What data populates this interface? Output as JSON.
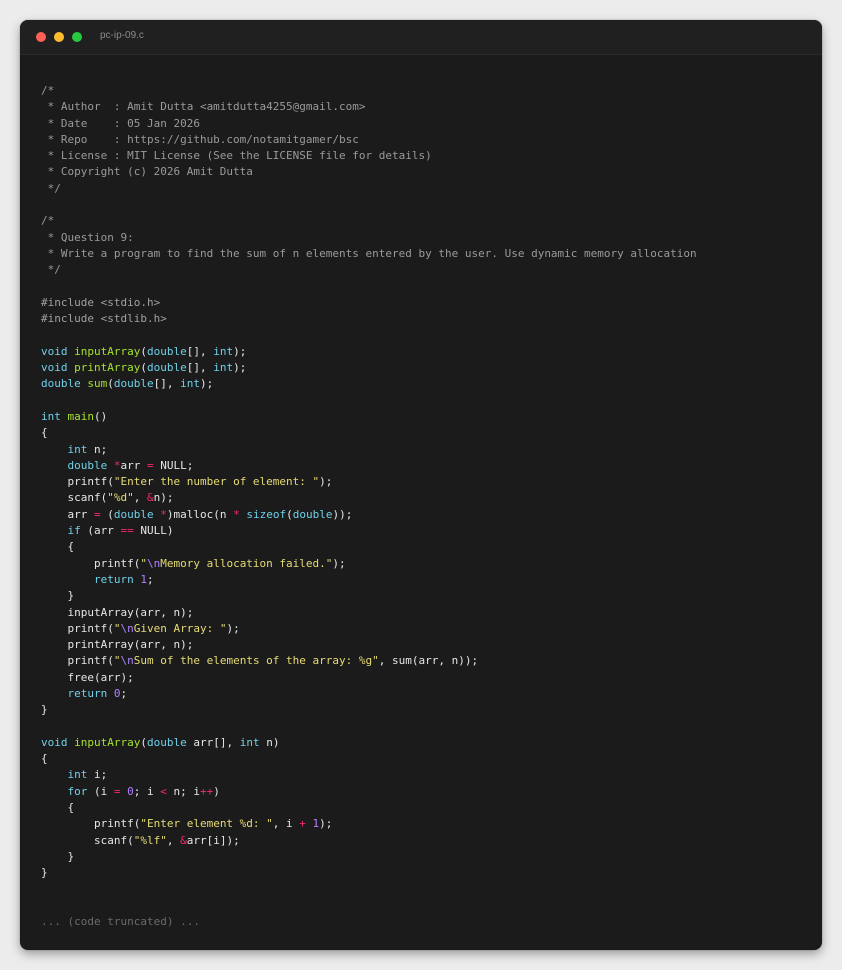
{
  "window": {
    "filename": "pc-ip-09.c"
  },
  "code_lines": [
    [
      [
        "c",
        "/*"
      ]
    ],
    [
      [
        "c",
        " * Author  : Amit Dutta <amitdutta4255@gmail.com>"
      ]
    ],
    [
      [
        "c",
        " * Date    : 05 Jan 2026"
      ]
    ],
    [
      [
        "c",
        " * Repo    : https://github.com/notamitgamer/bsc"
      ]
    ],
    [
      [
        "c",
        " * License : MIT License (See the LICENSE file for details)"
      ]
    ],
    [
      [
        "c",
        " * Copyright (c) 2026 Amit Dutta"
      ]
    ],
    [
      [
        "c",
        " */"
      ]
    ],
    [],
    [
      [
        "c",
        "/*"
      ]
    ],
    [
      [
        "c",
        " * Question 9:"
      ]
    ],
    [
      [
        "c",
        " * Write a program to find the sum of n elements entered by the user. Use dynamic memory allocation"
      ]
    ],
    [
      [
        "c",
        " */"
      ]
    ],
    [],
    [
      [
        "p",
        "#include <stdio.h>"
      ]
    ],
    [
      [
        "p",
        "#include <stdlib.h>"
      ]
    ],
    [],
    [
      [
        "k",
        "void"
      ],
      [
        "t",
        " "
      ],
      [
        "f",
        "inputArray"
      ],
      [
        "t",
        "("
      ],
      [
        "k",
        "double"
      ],
      [
        "t",
        "[], "
      ],
      [
        "k",
        "int"
      ],
      [
        "t",
        ");"
      ]
    ],
    [
      [
        "k",
        "void"
      ],
      [
        "t",
        " "
      ],
      [
        "f",
        "printArray"
      ],
      [
        "t",
        "("
      ],
      [
        "k",
        "double"
      ],
      [
        "t",
        "[], "
      ],
      [
        "k",
        "int"
      ],
      [
        "t",
        ");"
      ]
    ],
    [
      [
        "k",
        "double"
      ],
      [
        "t",
        " "
      ],
      [
        "f",
        "sum"
      ],
      [
        "t",
        "("
      ],
      [
        "k",
        "double"
      ],
      [
        "t",
        "[], "
      ],
      [
        "k",
        "int"
      ],
      [
        "t",
        ");"
      ]
    ],
    [],
    [
      [
        "k",
        "int"
      ],
      [
        "t",
        " "
      ],
      [
        "f",
        "main"
      ],
      [
        "t",
        "()"
      ]
    ],
    [
      [
        "t",
        "{"
      ]
    ],
    [
      [
        "t",
        "    "
      ],
      [
        "k",
        "int"
      ],
      [
        "t",
        " n;"
      ]
    ],
    [
      [
        "t",
        "    "
      ],
      [
        "k",
        "double"
      ],
      [
        "t",
        " "
      ],
      [
        "o",
        "*"
      ],
      [
        "t",
        "arr "
      ],
      [
        "o",
        "="
      ],
      [
        "t",
        " NULL;"
      ]
    ],
    [
      [
        "t",
        "    printf("
      ],
      [
        "s",
        "\"Enter the number of element: \""
      ],
      [
        "t",
        ");"
      ]
    ],
    [
      [
        "t",
        "    scanf("
      ],
      [
        "s",
        "\"%d\""
      ],
      [
        "t",
        ", "
      ],
      [
        "o",
        "&"
      ],
      [
        "t",
        "n);"
      ]
    ],
    [
      [
        "t",
        "    arr "
      ],
      [
        "o",
        "="
      ],
      [
        "t",
        " ("
      ],
      [
        "k",
        "double"
      ],
      [
        "t",
        " "
      ],
      [
        "o",
        "*"
      ],
      [
        "t",
        ")malloc(n "
      ],
      [
        "o",
        "*"
      ],
      [
        "t",
        " "
      ],
      [
        "k",
        "sizeof"
      ],
      [
        "t",
        "("
      ],
      [
        "k",
        "double"
      ],
      [
        "t",
        "));"
      ]
    ],
    [
      [
        "t",
        "    "
      ],
      [
        "k",
        "if"
      ],
      [
        "t",
        " (arr "
      ],
      [
        "o",
        "=="
      ],
      [
        "t",
        " NULL)"
      ]
    ],
    [
      [
        "t",
        "    {"
      ]
    ],
    [
      [
        "t",
        "        printf("
      ],
      [
        "s",
        "\""
      ],
      [
        "e",
        "\\n"
      ],
      [
        "s",
        "Memory allocation failed.\""
      ],
      [
        "t",
        ");"
      ]
    ],
    [
      [
        "t",
        "        "
      ],
      [
        "k",
        "return"
      ],
      [
        "t",
        " "
      ],
      [
        "n",
        "1"
      ],
      [
        "t",
        ";"
      ]
    ],
    [
      [
        "t",
        "    }"
      ]
    ],
    [
      [
        "t",
        "    inputArray(arr, n);"
      ]
    ],
    [
      [
        "t",
        "    printf("
      ],
      [
        "s",
        "\""
      ],
      [
        "e",
        "\\n"
      ],
      [
        "s",
        "Given Array: \""
      ],
      [
        "t",
        ");"
      ]
    ],
    [
      [
        "t",
        "    printArray(arr, n);"
      ]
    ],
    [
      [
        "t",
        "    printf("
      ],
      [
        "s",
        "\""
      ],
      [
        "e",
        "\\n"
      ],
      [
        "s",
        "Sum of the elements of the array: %g\""
      ],
      [
        "t",
        ", sum(arr, n));"
      ]
    ],
    [
      [
        "t",
        "    free(arr);"
      ]
    ],
    [
      [
        "t",
        "    "
      ],
      [
        "k",
        "return"
      ],
      [
        "t",
        " "
      ],
      [
        "n",
        "0"
      ],
      [
        "t",
        ";"
      ]
    ],
    [
      [
        "t",
        "}"
      ]
    ],
    [],
    [
      [
        "k",
        "void"
      ],
      [
        "t",
        " "
      ],
      [
        "f",
        "inputArray"
      ],
      [
        "t",
        "("
      ],
      [
        "k",
        "double"
      ],
      [
        "t",
        " arr[], "
      ],
      [
        "k",
        "int"
      ],
      [
        "t",
        " n)"
      ]
    ],
    [
      [
        "t",
        "{"
      ]
    ],
    [
      [
        "t",
        "    "
      ],
      [
        "k",
        "int"
      ],
      [
        "t",
        " i;"
      ]
    ],
    [
      [
        "t",
        "    "
      ],
      [
        "k",
        "for"
      ],
      [
        "t",
        " (i "
      ],
      [
        "o",
        "="
      ],
      [
        "t",
        " "
      ],
      [
        "n",
        "0"
      ],
      [
        "t",
        "; i "
      ],
      [
        "o",
        "<"
      ],
      [
        "t",
        " n; i"
      ],
      [
        "o",
        "++"
      ],
      [
        "t",
        ")"
      ]
    ],
    [
      [
        "t",
        "    {"
      ]
    ],
    [
      [
        "t",
        "        printf("
      ],
      [
        "s",
        "\"Enter element %d: \""
      ],
      [
        "t",
        ", i "
      ],
      [
        "o",
        "+"
      ],
      [
        "t",
        " "
      ],
      [
        "n",
        "1"
      ],
      [
        "t",
        ");"
      ]
    ],
    [
      [
        "t",
        "        scanf("
      ],
      [
        "s",
        "\"%lf\""
      ],
      [
        "t",
        ", "
      ],
      [
        "o",
        "&"
      ],
      [
        "t",
        "arr[i]);"
      ]
    ],
    [
      [
        "t",
        "    }"
      ]
    ],
    [
      [
        "t",
        "}"
      ]
    ],
    [],
    [],
    [
      [
        "trunc",
        "... (code truncated) ..."
      ]
    ]
  ]
}
